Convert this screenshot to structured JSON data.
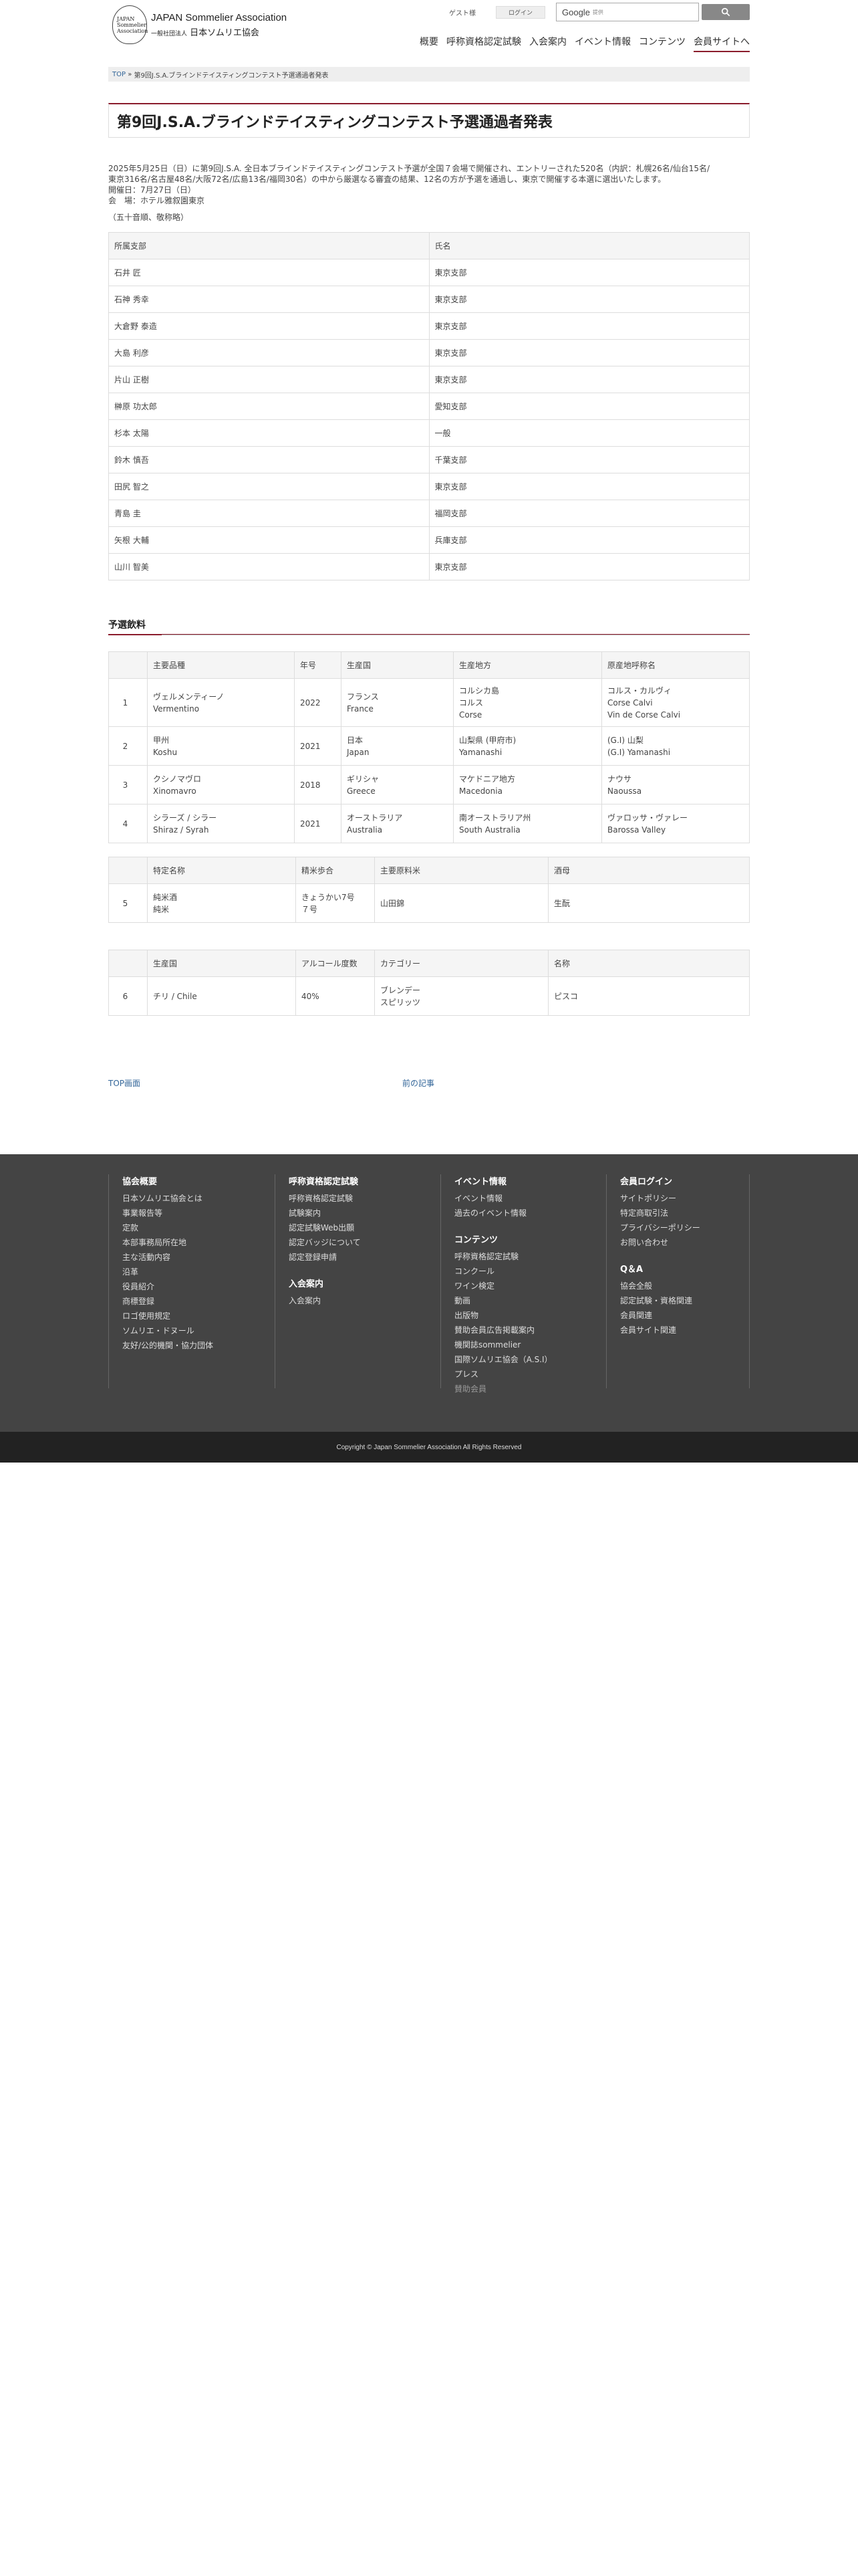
{
  "header": {
    "logo_mark_lines": [
      "JAPAN",
      "Sommelier",
      "Association"
    ],
    "logo_en": "JAPAN Sommelier Association",
    "logo_jp_prefix": "一般社団法人",
    "logo_jp_main": "日本ソムリエ協会",
    "guest": "ゲスト様",
    "login": "ログイン",
    "search_brand": "Google",
    "search_suffix": "提供",
    "nav": [
      "概要",
      "呼称資格認定試験",
      "入会案内",
      "イベント情報",
      "コンテンツ",
      "会員サイトへ"
    ]
  },
  "breadcrumb": {
    "top": "TOP",
    "sep": "»",
    "current": "第9回J.S.A.ブラインドテイスティングコンテスト予選通過者発表"
  },
  "page_title": "第9回J.S.A.ブラインドテイスティングコンテスト予選通過者発表",
  "intro": {
    "line1": "2025年5月25日（日）に第9回J.S.A. 全日本ブラインドテイスティングコンテスト予選が全国７会場で開催され、エントリーされた520名（内訳：札幌26名/仙台15名/",
    "line2": "東京316名/名古屋48名/大阪72名/広島13名/福岡30名）の中から厳選なる審査の結果、12名の方が予選を通過し、東京で開催する本選に選出いたします。",
    "line3": "開催日：7月27日（日）",
    "line4": "会　場：ホテル雅叙園東京",
    "note": "（五十音順、敬称略）"
  },
  "finalists": {
    "headers": [
      "所属支部",
      "氏名"
    ],
    "rows": [
      [
        "石井 匠",
        "東京支部"
      ],
      [
        "石神 秀幸",
        "東京支部"
      ],
      [
        "大倉野 泰造",
        "東京支部"
      ],
      [
        "大島 利彦",
        "東京支部"
      ],
      [
        "片山 正樹",
        "東京支部"
      ],
      [
        "榊原 功太郎",
        "愛知支部"
      ],
      [
        "杉本 太陽",
        "一般"
      ],
      [
        "鈴木 慎吾",
        "千葉支部"
      ],
      [
        "田尻 智之",
        "東京支部"
      ],
      [
        "青島 圭",
        "福岡支部"
      ],
      [
        "矢根 大輔",
        "兵庫支部"
      ],
      [
        "山川 智美",
        "東京支部"
      ]
    ]
  },
  "section_title": "予選飲料",
  "wines": {
    "headers": [
      "",
      "主要品種",
      "年号",
      "生産国",
      "生産地方",
      "原産地呼称名"
    ],
    "rows": [
      {
        "no": "1",
        "variety": [
          "ヴェルメンティーノ",
          "Vermentino"
        ],
        "year": "2022",
        "country": [
          "フランス",
          "France"
        ],
        "region": [
          "コルシカ島",
          "コルス",
          "Corse"
        ],
        "ao": [
          "コルス・カルヴィ",
          "Corse Calvi",
          "Vin de Corse Calvi"
        ]
      },
      {
        "no": "2",
        "variety": [
          "甲州",
          "Koshu"
        ],
        "year": "2021",
        "country": [
          "日本",
          "Japan"
        ],
        "region": [
          "山梨県 (甲府市)",
          "Yamanashi"
        ],
        "ao": [
          "(G.I) 山梨",
          "(G.I) Yamanashi"
        ]
      },
      {
        "no": "3",
        "variety": [
          "クシノマヴロ",
          "Xinomavro"
        ],
        "year": "2018",
        "country": [
          "ギリシャ",
          "Greece"
        ],
        "region": [
          "マケドニア地方",
          "Macedonia"
        ],
        "ao": [
          "ナウサ",
          "Naoussa"
        ]
      },
      {
        "no": "4",
        "variety": [
          "シラーズ / シラー",
          "Shiraz / Syrah"
        ],
        "year": "2021",
        "country": [
          "オーストラリア",
          "Australia"
        ],
        "region": [
          "南オーストラリア州",
          "South Australia"
        ],
        "ao": [
          "ヴァロッサ・ヴァレー",
          "Barossa Valley"
        ]
      }
    ]
  },
  "sake": {
    "headers": [
      "",
      "特定名称",
      "精米歩合",
      "主要原料米",
      "酒母"
    ],
    "row": {
      "no": "5",
      "name": [
        "純米酒",
        "純米"
      ],
      "polish": [
        "きょうかい7号",
        "７号"
      ],
      "rice": "山田錦",
      "moto": "生酛"
    }
  },
  "spirit": {
    "headers": [
      "",
      "生産国",
      "アルコール度数",
      "カテゴリー",
      "名称"
    ],
    "row": {
      "no": "6",
      "country": "チリ / Chile",
      "abv": "40%",
      "category": [
        "ブレンデー",
        "スピリッツ"
      ],
      "name": "ピスコ"
    }
  },
  "pager": {
    "top": "TOP画面",
    "prev": "前の記事"
  },
  "footer": {
    "col1": {
      "title": "協会概要",
      "links": [
        "日本ソムリエ協会とは",
        "事業報告等",
        "定款",
        "本部事務局所在地",
        "主な活動内容",
        "沿革",
        "役員紹介",
        "商標登録",
        "ロゴ使用規定",
        "ソムリエ・ドヌール",
        "友好/公的機関・協力団体"
      ]
    },
    "col2": {
      "title": "呼称資格認定試験",
      "links": [
        "呼称資格認定試験",
        "試験案内",
        "認定試験Web出願",
        "認定バッジについて",
        "認定登録申請"
      ],
      "title2": "入会案内",
      "links2": [
        "入会案内"
      ]
    },
    "col3": {
      "title": "イベント情報",
      "links": [
        "イベント情報",
        "過去のイベント情報"
      ],
      "title2": "コンテンツ",
      "links2": [
        "呼称資格認定試験",
        "コンクール",
        "ワイン検定",
        "動画",
        "出版物",
        "賛助会員広告掲載案内",
        "機関誌sommelier",
        "国際ソムリエ協会（A.S.I）",
        "プレス"
      ],
      "dim_link": "賛助会員"
    },
    "col4": {
      "title": "会員ログイン",
      "links": [
        "サイトポリシー",
        "特定商取引法",
        "プライバシーポリシー",
        "お問い合わせ"
      ],
      "title2": "Q＆A",
      "links2": [
        "協会全般",
        "認定試験・資格関連",
        "会員関連",
        "会員サイト関連"
      ]
    },
    "copyright": "Copyright © Japan Sommelier Association All Rights Reserved"
  }
}
